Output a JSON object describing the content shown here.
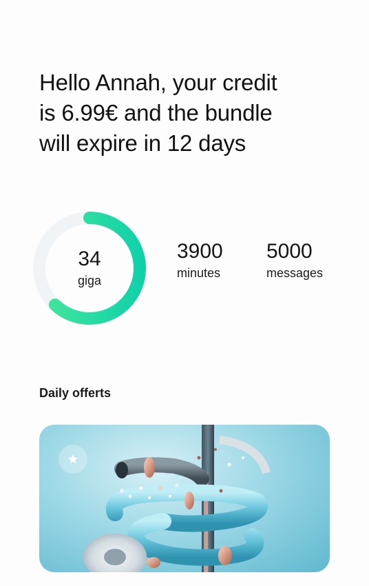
{
  "greeting": {
    "line1": "Hello Annah, your credit",
    "line2": "is 6.99€ and the bundle",
    "line3": "will expire in 12 days"
  },
  "bundle": {
    "data": {
      "value": "34",
      "unit": "giga",
      "remaining_fraction": 0.62
    },
    "minutes": {
      "value": "3900",
      "unit": "minutes"
    },
    "messages": {
      "value": "5000",
      "unit": "messages"
    }
  },
  "offers": {
    "title": "Daily offerts",
    "card_icon": "star-icon"
  },
  "colors": {
    "ring_start": "#3ee39a",
    "ring_end": "#13d3a8",
    "ring_track": "#f1f4f7",
    "card_bg": "#9dd8e6"
  }
}
